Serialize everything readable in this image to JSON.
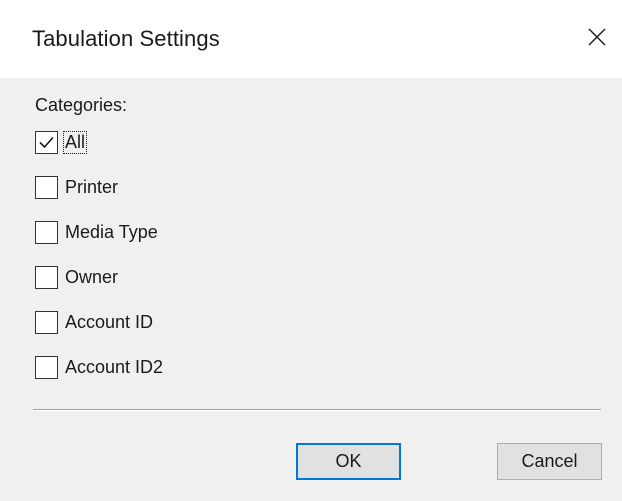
{
  "window": {
    "title": "Tabulation Settings",
    "close_icon": "close-icon"
  },
  "categories": {
    "label": "Categories:",
    "items": [
      {
        "label": "All",
        "checked": true,
        "focused": true
      },
      {
        "label": "Printer",
        "checked": false,
        "focused": false
      },
      {
        "label": "Media Type",
        "checked": false,
        "focused": false
      },
      {
        "label": "Owner",
        "checked": false,
        "focused": false
      },
      {
        "label": "Account ID",
        "checked": false,
        "focused": false
      },
      {
        "label": "Account ID2",
        "checked": false,
        "focused": false
      }
    ]
  },
  "buttons": {
    "ok": "OK",
    "cancel": "Cancel"
  },
  "colors": {
    "content_bg": "#f0f0f0",
    "default_button_border": "#0078d7",
    "button_bg": "#e1e1e1"
  }
}
